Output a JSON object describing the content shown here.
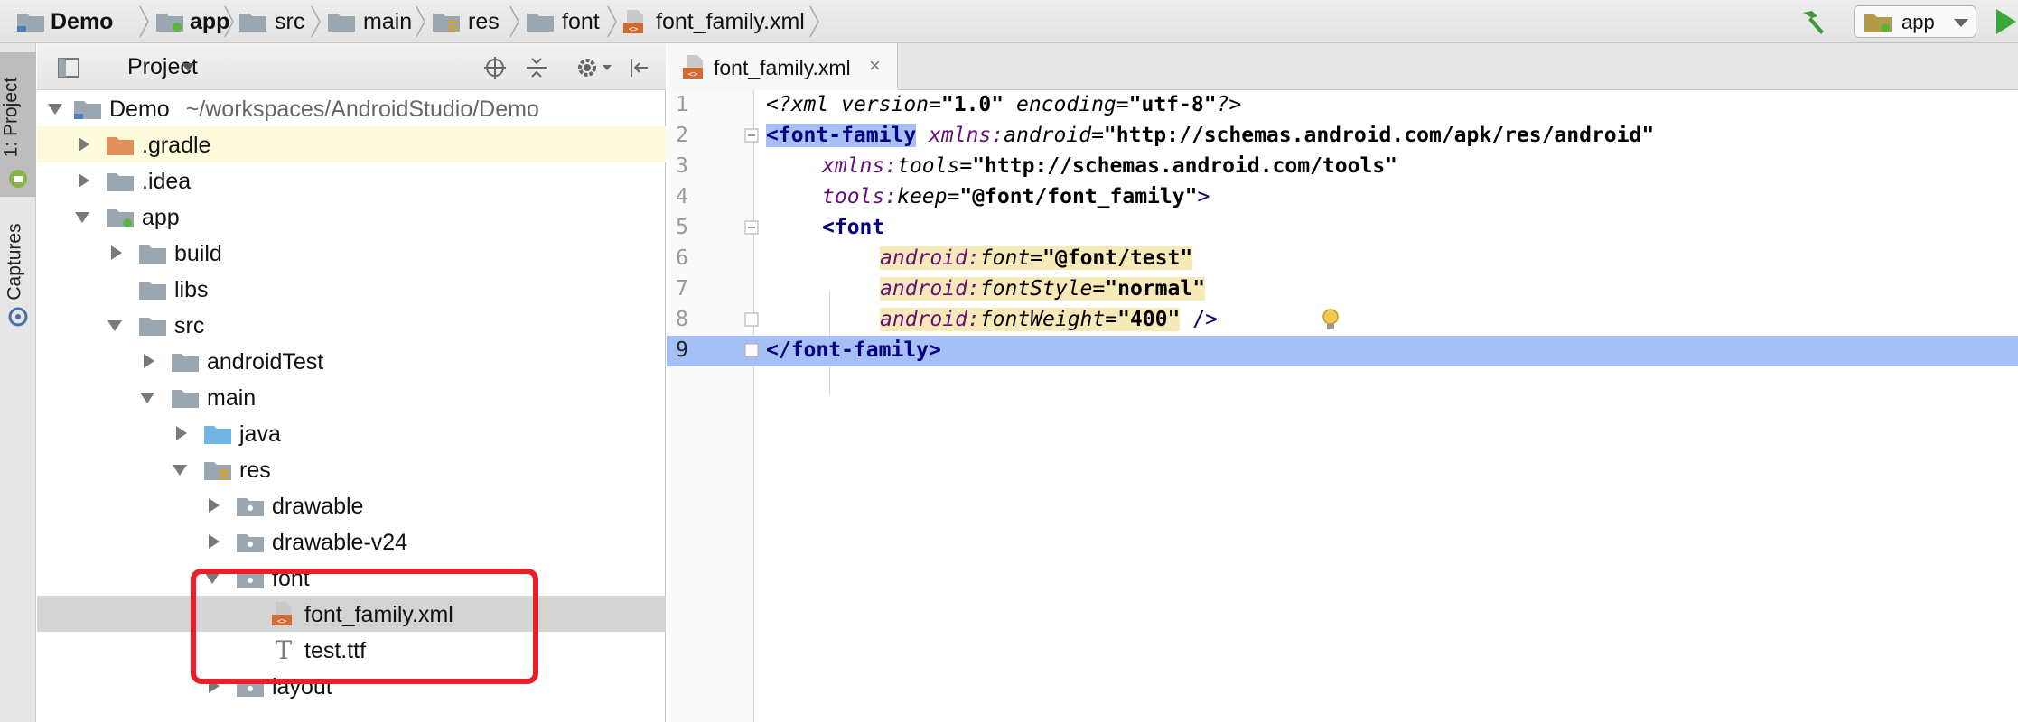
{
  "breadcrumb": [
    {
      "label": "Demo",
      "icon": "project-folder-icon",
      "bold": true
    },
    {
      "label": "app",
      "icon": "module-folder-icon",
      "bold": true
    },
    {
      "label": "src",
      "icon": "folder-icon",
      "bold": false
    },
    {
      "label": "main",
      "icon": "folder-icon",
      "bold": false
    },
    {
      "label": "res",
      "icon": "resource-folder-icon",
      "bold": false
    },
    {
      "label": "font",
      "icon": "folder-icon",
      "bold": false
    },
    {
      "label": "font_family.xml",
      "icon": "xml-file-icon",
      "bold": false
    }
  ],
  "toolbar": {
    "run_config_label": "app",
    "build_icon": "hammer-icon",
    "run_icon": "run-icon"
  },
  "tool_strip": {
    "project_tab": "1: Project",
    "captures_tab": "Captures"
  },
  "project_panel": {
    "title": "Project",
    "header_icons": [
      "target-icon",
      "collapse-all-icon",
      "gear-icon",
      "hide-panel-icon"
    ]
  },
  "tree": [
    {
      "label": "Demo",
      "path": "~/workspaces/AndroidStudio/Demo",
      "depth": 0,
      "state": "expanded",
      "icon": "project-folder-icon"
    },
    {
      "label": ".gradle",
      "depth": 1,
      "state": "collapsed",
      "icon": "orange-folder-icon",
      "highlighted": true
    },
    {
      "label": ".idea",
      "depth": 1,
      "state": "collapsed",
      "icon": "folder-icon"
    },
    {
      "label": "app",
      "depth": 1,
      "state": "expanded",
      "icon": "module-folder-icon"
    },
    {
      "label": "build",
      "depth": 2,
      "state": "collapsed",
      "icon": "folder-icon"
    },
    {
      "label": "libs",
      "depth": 2,
      "state": "none",
      "icon": "folder-icon"
    },
    {
      "label": "src",
      "depth": 2,
      "state": "expanded",
      "icon": "folder-icon"
    },
    {
      "label": "androidTest",
      "depth": 3,
      "state": "collapsed",
      "icon": "folder-icon"
    },
    {
      "label": "main",
      "depth": 3,
      "state": "expanded",
      "icon": "folder-icon"
    },
    {
      "label": "java",
      "depth": 4,
      "state": "collapsed",
      "icon": "source-folder-icon"
    },
    {
      "label": "res",
      "depth": 4,
      "state": "expanded",
      "icon": "resource-folder-icon"
    },
    {
      "label": "drawable",
      "depth": 5,
      "state": "collapsed",
      "icon": "package-folder-icon"
    },
    {
      "label": "drawable-v24",
      "depth": 5,
      "state": "collapsed",
      "icon": "package-folder-icon"
    },
    {
      "label": "font",
      "depth": 5,
      "state": "expanded",
      "icon": "package-folder-icon"
    },
    {
      "label": "font_family.xml",
      "depth": 6,
      "state": "none",
      "icon": "xml-file-icon",
      "selected": true
    },
    {
      "label": "test.ttf",
      "depth": 6,
      "state": "none",
      "icon": "font-file-icon"
    },
    {
      "label": "layout",
      "depth": 5,
      "state": "collapsed",
      "icon": "package-folder-icon"
    }
  ],
  "editor": {
    "tab_label": "font_family.xml",
    "close_glyph": "×",
    "current_line": 9,
    "lines": [
      "1",
      "2",
      "3",
      "4",
      "5",
      "6",
      "7",
      "8",
      "9"
    ]
  },
  "code": {
    "l1_open": "<?",
    "l1_xml": "xml version",
    "l1_eq1": "=",
    "l1_v1": "\"1.0\"",
    "l1_enc": " encoding",
    "l1_eq2": "=",
    "l1_v2": "\"utf-8\"",
    "l1_close": "?>",
    "l2_tag": "<font-family",
    "l2_ns": "xmlns:",
    "l2_attr": "android",
    "l2_eq": "=",
    "l2_val": "\"http://schemas.android.com/apk/res/android\"",
    "l3_ns": "xmlns:",
    "l3_attr": "tools",
    "l3_eq": "=",
    "l3_val": "\"http://schemas.android.com/tools\"",
    "l4_ns": "tools:",
    "l4_attr": "keep",
    "l4_eq": "=",
    "l4_val": "\"@font/font_family\"",
    "l4_close": ">",
    "l5_tag": "<font",
    "l6_ns": "android:",
    "l6_attr": "font",
    "l6_eq": "=",
    "l6_val": "\"@font/test\"",
    "l7_ns": "android:",
    "l7_attr": "fontStyle",
    "l7_eq": "=",
    "l7_val": "\"normal\"",
    "l8_ns": "android:",
    "l8_attr": "fontWeight",
    "l8_eq": "=",
    "l8_val": "\"400\"",
    "l8_close": " />",
    "l9_tag": "</font-family>",
    "bulb_icon": "lightbulb-icon"
  }
}
